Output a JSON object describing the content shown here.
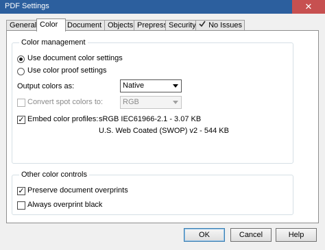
{
  "window": {
    "title": "PDF Settings",
    "close_glyph": "✕"
  },
  "tabs": [
    {
      "label": "General"
    },
    {
      "label": "Color"
    },
    {
      "label": "Document"
    },
    {
      "label": "Objects"
    },
    {
      "label": "Prepress"
    },
    {
      "label": "Security"
    },
    {
      "label": "No Issues"
    }
  ],
  "color_management": {
    "title": "Color management",
    "use_document_label": "Use document color settings",
    "use_proof_label": "Use color proof settings",
    "selected": "use_document",
    "output_colors_label": "Output colors as:",
    "output_colors_value": "Native",
    "convert_spot_label": "Convert spot colors to:",
    "convert_spot_checked": false,
    "convert_spot_value": "RGB",
    "embed_profiles_label": "Embed color profiles:",
    "embed_profiles_checked": true,
    "profiles": [
      "sRGB IEC61966-2.1 - 3.07 KB",
      "U.S. Web Coated (SWOP) v2 - 544 KB"
    ]
  },
  "other_controls": {
    "title": "Other color controls",
    "preserve_overprints_label": "Preserve document overprints",
    "preserve_overprints_checked": true,
    "always_overprint_label": "Always overprint black",
    "always_overprint_checked": false
  },
  "buttons": {
    "ok": "OK",
    "cancel": "Cancel",
    "help": "Help"
  },
  "check_glyph": "✓"
}
